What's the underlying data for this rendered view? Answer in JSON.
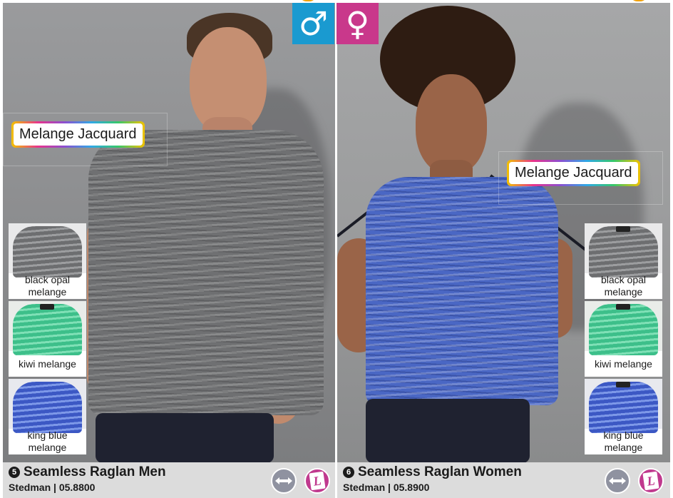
{
  "badges": {
    "male_symbol": "♂",
    "female_symbol": "♀",
    "male_color": "#1a9ad0",
    "female_color": "#c9388b"
  },
  "left": {
    "feature_label": "Melange Jacquard",
    "swatches": [
      {
        "label": "black opal melange",
        "color": "#6d6e70"
      },
      {
        "label": "kiwi melange",
        "color": "#3dbf8a"
      },
      {
        "label": "king blue melange",
        "color": "#3c58c4"
      }
    ],
    "product": {
      "number": "5",
      "title": "Seamless Raglan Men",
      "subtitle": "Stedman | 05.8800"
    },
    "icons": [
      "stretch-icon",
      "label-l-icon"
    ]
  },
  "right": {
    "feature_label": "Melange Jacquard",
    "swatches": [
      {
        "label": "black opal melange",
        "color": "#6d6e70"
      },
      {
        "label": "kiwi melange",
        "color": "#3dbf8a"
      },
      {
        "label": "king blue melange",
        "color": "#3c58c4"
      }
    ],
    "product": {
      "number": "6",
      "title": "Seamless Raglan Women",
      "subtitle": "Stedman | 05.8900"
    },
    "icons": [
      "stretch-icon",
      "label-l-icon"
    ]
  },
  "icon_text": {
    "l_mark": "L"
  }
}
